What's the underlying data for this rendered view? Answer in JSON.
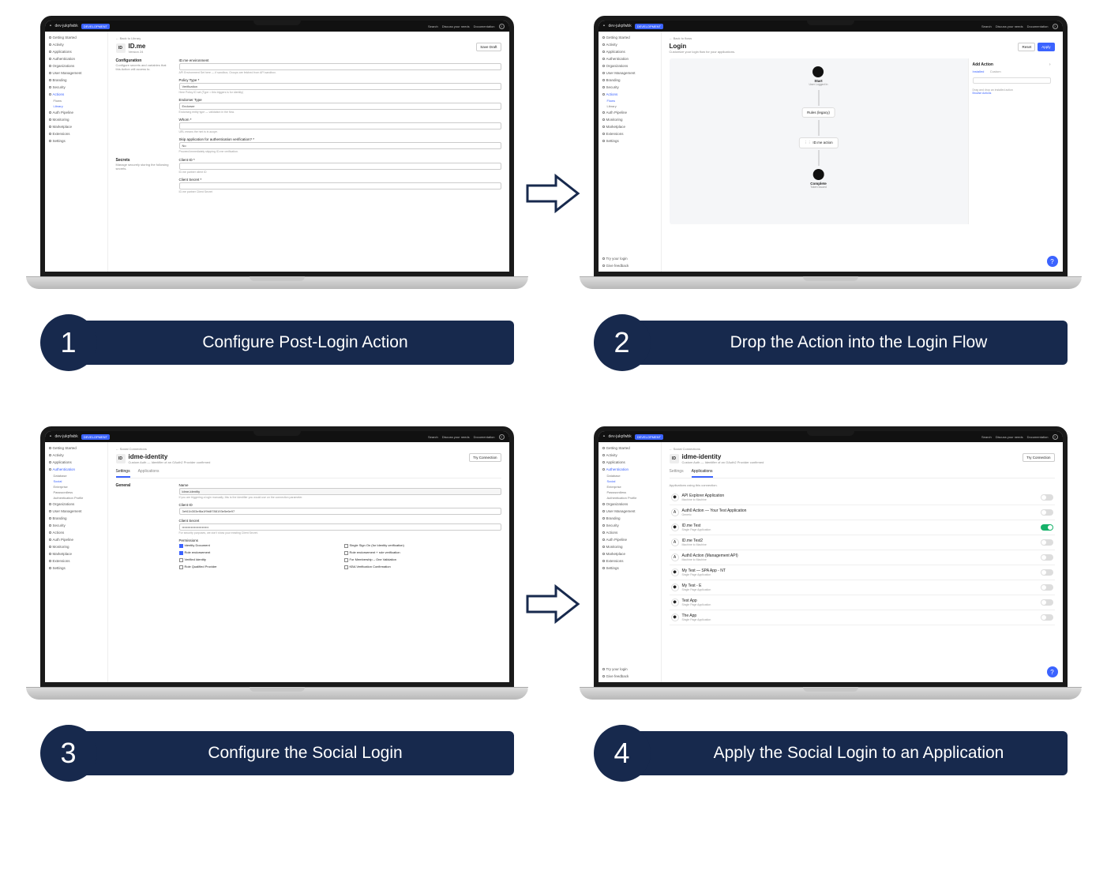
{
  "steps": [
    {
      "num": "1",
      "label": "Configure Post-Login Action"
    },
    {
      "num": "2",
      "label": "Drop the Action into the Login Flow"
    },
    {
      "num": "3",
      "label": "Configure the Social Login"
    },
    {
      "num": "4",
      "label": "Apply the Social Login to an Application"
    }
  ],
  "topbar": {
    "tenant": "dev-jukpfwbk",
    "env": "DEVELOPMENT",
    "links": [
      "Search",
      "Discuss your needs",
      "Documentation"
    ]
  },
  "sidebar_full": [
    "Getting Started",
    "Activity",
    "Applications",
    "Authentication",
    "Organizations",
    "User Management",
    "Branding",
    "Security",
    "Actions",
    "Auth Pipeline",
    "Monitoring",
    "Marketplace",
    "Extensions",
    "Settings"
  ],
  "actions_subnav": [
    "Flows",
    "Library"
  ],
  "auth_subnav": [
    "Database",
    "Social",
    "Enterprise",
    "Passwordless",
    "Authentication Profile"
  ],
  "step1": {
    "crumb": "← Back to Library",
    "title": "ID.me",
    "version": "Version 24",
    "btn": "Save Draft",
    "sections": {
      "config": {
        "title": "Configuration",
        "desc": "Configure secrets and variables that this Action will access to.",
        "fields": {
          "client_id_label": "ID.me environment",
          "client_id_hint": "API Environment Set here — if sandbox, Groups are fetched from API sandbox.",
          "policy_type_label": "Policy Type *",
          "policy_type_value": "Verification",
          "policy_type_hint": "Here Policy ID set (Type = this triggers is for identity)",
          "endorser_label": "Endorser Type",
          "endorser_value": "Endorser",
          "endorser_hint": "Endorsing entity type — validation in the flow.",
          "whom_label": "Whom *",
          "whom_hint": "URL means the hint is in-scope.",
          "skip_label": "Skip application for authentication verification? *",
          "skip_value": "No",
          "skip_hint": "Proceed immediately skipping ID.me verification."
        }
      },
      "secrets": {
        "title": "Secrets",
        "desc": "Manage securely storing the following secrets.",
        "fields": {
          "cid_label": "Client ID *",
          "cid_hint": "ID.me partner client ID",
          "cs_label": "Client Secret *",
          "cs_hint": "ID.me partner Client Secret"
        }
      }
    }
  },
  "step2": {
    "crumb": "← Back to flows",
    "title": "Login",
    "sub": "Customize your login flow for your applications.",
    "btns": {
      "reset": "Reset",
      "apply": "Apply"
    },
    "nodes": {
      "start": "Start",
      "start_sub": "User Logged In",
      "rules": "Rules (legacy)",
      "idme": "ID.me action",
      "complete": "Complete",
      "complete_sub": "Token Issued"
    },
    "panel": {
      "title": "Add Action",
      "tabs": [
        "Installed",
        "Custom"
      ],
      "search_ph": "Search actions",
      "note": "Drag and drop an installed action",
      "link": "Browse Actions"
    },
    "footer": [
      "Try your login",
      "Give feedback"
    ]
  },
  "step3": {
    "crumb": "← Social Connections",
    "title": "idme-identity",
    "sub": "Custom Auth — Identifier of an OAuth2 Provider confirmed",
    "btn": "Try Connection",
    "tabs": [
      "Settings",
      "Applications"
    ],
    "section": "General",
    "fields": {
      "name_label": "Name",
      "name_value": "idme-identity",
      "name_hint": "If you are triggering a login manually, this is the identifier you would use on the connection parameter.",
      "cid_label": "Client ID",
      "cid_value": "3ef41b303ef8a1f9b8f788193e5e6e97",
      "cs_label": "Client Secret",
      "cs_value": "••••••••••••••••••••••••",
      "cs_hint": "For security purposes, we don't show your existing Client Secret.",
      "perm_label": "Permissions"
    },
    "permissions": [
      {
        "label": "Identity Document",
        "checked": true
      },
      {
        "label": "Single Sign On (for Identity verification)",
        "checked": false
      },
      {
        "label": "Role endorsement",
        "checked": true
      },
      {
        "label": "Role endorsement + role verification",
        "checked": false
      },
      {
        "label": "Verified Identity",
        "checked": false
      },
      {
        "label": "For Membership – One Validation",
        "checked": false
      },
      {
        "label": "Role Qualified Provider",
        "checked": false
      },
      {
        "label": "KBA Verification Confirmation",
        "checked": false
      }
    ]
  },
  "step4": {
    "crumb": "← Social Connections",
    "title": "idme-identity",
    "sub": "Custom Auth — Identifier of an OAuth2 Provider confirmed",
    "btn": "Try Connection",
    "tabs": [
      "Settings",
      "Applications"
    ],
    "apps_intro": "Applications using this connection.",
    "apps": [
      {
        "name": "API Explorer Application",
        "type": "Machine to Machine",
        "on": false,
        "icon": "⬢"
      },
      {
        "name": "Auth0 Action — Your Test Application",
        "type": "Generic",
        "on": false,
        "icon": "A"
      },
      {
        "name": "ID.me Test",
        "type": "Single Page Application",
        "on": true,
        "icon": "⬢"
      },
      {
        "name": "ID.me Test2",
        "type": "Machine to Machine",
        "on": false,
        "icon": "A"
      },
      {
        "name": "Auth0 Action (Management API)",
        "type": "Machine to Machine",
        "on": false,
        "icon": "A"
      },
      {
        "name": "My Test — SPA App - NT",
        "type": "Single Page Application",
        "on": false,
        "icon": "⬢"
      },
      {
        "name": "My Test - E",
        "type": "Single Page Application",
        "on": false,
        "icon": "⬢"
      },
      {
        "name": "Test App",
        "type": "Single Page Application",
        "on": false,
        "icon": "⬢"
      },
      {
        "name": "The App",
        "type": "Single Page Application",
        "on": false,
        "icon": "⬢"
      }
    ]
  }
}
